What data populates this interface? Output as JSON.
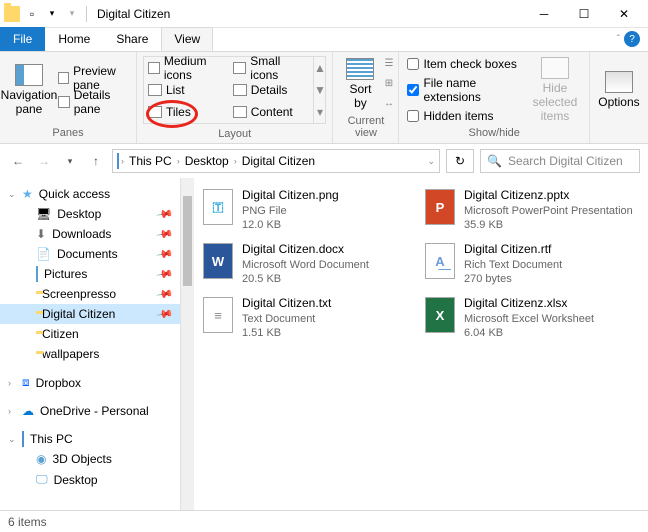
{
  "window": {
    "title": "Digital Citizen"
  },
  "tabs": {
    "file": "File",
    "home": "Home",
    "share": "Share",
    "view": "View"
  },
  "ribbon": {
    "panes": {
      "nav": "Navigation\npane",
      "preview": "Preview pane",
      "details": "Details pane",
      "label": "Panes"
    },
    "layout": {
      "medium": "Medium icons",
      "small": "Small icons",
      "list": "List",
      "details": "Details",
      "tiles": "Tiles",
      "content": "Content",
      "label": "Layout"
    },
    "sort": {
      "label": "Sort\nby",
      "group_label": "Current view"
    },
    "showhide": {
      "item_check": "Item check boxes",
      "ext": "File name extensions",
      "hidden": "Hidden items",
      "hide_sel": "Hide selected\nitems",
      "label": "Show/hide"
    },
    "options": "Options"
  },
  "breadcrumb": {
    "items": [
      "This PC",
      "Desktop",
      "Digital Citizen"
    ]
  },
  "search": {
    "placeholder": "Search Digital Citizen"
  },
  "nav": {
    "quick": "Quick access",
    "items": [
      {
        "label": "Desktop",
        "pin": true
      },
      {
        "label": "Downloads",
        "pin": true
      },
      {
        "label": "Documents",
        "pin": true
      },
      {
        "label": "Pictures",
        "pin": true
      },
      {
        "label": "Screenpresso",
        "pin": true
      },
      {
        "label": "Digital Citizen",
        "pin": true,
        "sel": true
      },
      {
        "label": "Citizen"
      },
      {
        "label": "wallpapers"
      }
    ],
    "dropbox": "Dropbox",
    "onedrive": "OneDrive - Personal",
    "thispc": "This PC",
    "pc_items": [
      "3D Objects",
      "Desktop"
    ]
  },
  "files": [
    {
      "name": "Digital Citizen.png",
      "type": "PNG File",
      "size": "12.0 KB",
      "icon": "png"
    },
    {
      "name": "Digital Citizenz.pptx",
      "type": "Microsoft PowerPoint Presentation",
      "size": "35.9 KB",
      "icon": "pptx"
    },
    {
      "name": "Digital Citizen.docx",
      "type": "Microsoft Word Document",
      "size": "20.5 KB",
      "icon": "docx"
    },
    {
      "name": "Digital Citizen.rtf",
      "type": "Rich Text Document",
      "size": "270 bytes",
      "icon": "rtf"
    },
    {
      "name": "Digital Citizen.txt",
      "type": "Text Document",
      "size": "1.51 KB",
      "icon": "txt"
    },
    {
      "name": "Digital Citizenz.xlsx",
      "type": "Microsoft Excel Worksheet",
      "size": "6.04 KB",
      "icon": "xlsx"
    }
  ],
  "status": {
    "count": "6 items"
  }
}
